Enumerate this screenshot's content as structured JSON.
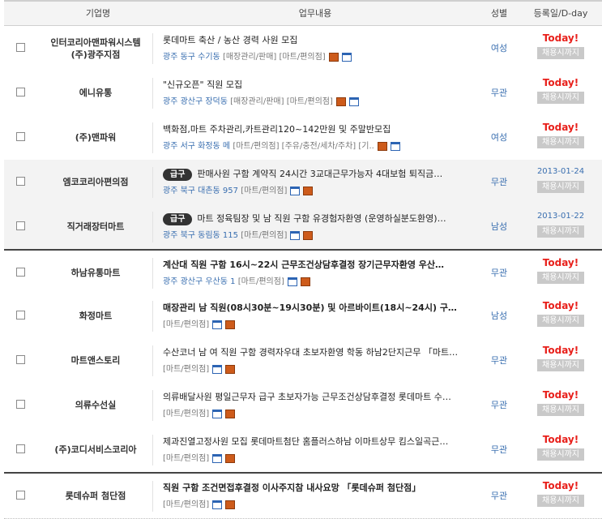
{
  "header": {
    "company": "기업명",
    "job": "업무내용",
    "gender": "성별",
    "date": "등록일/D-day"
  },
  "rows": [
    {
      "company": "인터코리아맨파워시스템\n(주)광주지점",
      "title": "롯데마트 축산 / 농산 경력 사원 모집",
      "bold": false,
      "badge": "",
      "location": "광주 동구 수기동",
      "categories": "[매장관리/판매] [마트/편의점]",
      "icons": [
        "scrap",
        "win"
      ],
      "gender": "여성",
      "date_type": "today",
      "date": "Today!",
      "closing": "채용시까지",
      "style": "white"
    },
    {
      "company": "에니유통",
      "title": "\"신규오픈\" 직원 모집",
      "bold": false,
      "badge": "",
      "location": "광주 광산구 장덕동",
      "categories": "[매장관리/판매] [마트/편의점]",
      "icons": [
        "scrap",
        "win"
      ],
      "gender": "무관",
      "date_type": "today",
      "date": "Today!",
      "closing": "채용시까지",
      "style": "white"
    },
    {
      "company": "(주)맨파워",
      "title": "백화점,마트 주차관리,카트관리120~142만원 및 주말반모집",
      "bold": false,
      "badge": "",
      "location": "광주 서구 화정동 메",
      "categories": "[마트/편의점] [주유/충전/세차/주차] [기..",
      "icons": [
        "scrap",
        "win"
      ],
      "gender": "여성",
      "date_type": "today",
      "date": "Today!",
      "closing": "채용시까지",
      "style": "white"
    },
    {
      "company": "엠코코리아편의점",
      "title": "판매사원 구함 계약직 24시간 3교대근무가능자 4대보험 퇴직금…",
      "bold": false,
      "badge": "급구",
      "location": "광주 북구 대촌동 957",
      "categories": "[마트/편의점]",
      "icons": [
        "win",
        "scrap"
      ],
      "gender": "무관",
      "date_type": "date",
      "date": "2013-01-24",
      "closing": "채용시까지",
      "style": "gray"
    },
    {
      "company": "직거래장터마트",
      "title": "마트 정육팀장 및 남 직원 구함 유경험자환영 (운영하실분도환영)…",
      "bold": false,
      "badge": "급구",
      "location": "광주 북구 동림동 115",
      "categories": "[마트/편의점]",
      "icons": [
        "win",
        "scrap"
      ],
      "gender": "남성",
      "date_type": "date",
      "date": "2013-01-22",
      "closing": "채용시까지",
      "style": "gray"
    },
    {
      "company": "하남유통마트",
      "title": "계산대 직원 구함 16시~22시 근무조건상담후결정 장기근무자환영 우산…",
      "bold": true,
      "badge": "",
      "location": "광주 광산구 우산동 1",
      "categories": "[마트/편의점]",
      "icons": [
        "win",
        "scrap"
      ],
      "gender": "무관",
      "date_type": "today",
      "date": "Today!",
      "closing": "채용시까지",
      "style": "sep"
    },
    {
      "company": "화정마트",
      "title": "매장관리 남 직원(08시30분~19시30분) 및 아르바이트(18시~24시) 구…",
      "bold": true,
      "badge": "",
      "location": "",
      "categories": "[마트/편의점]",
      "icons": [
        "win",
        "scrap"
      ],
      "gender": "남성",
      "date_type": "today",
      "date": "Today!",
      "closing": "채용시까지",
      "style": "white"
    },
    {
      "company": "마트앤스토리",
      "title": "수산코너 남 여 직원 구함 경력자우대 초보자환영 학동 하남2단지근무 「마트…",
      "bold": false,
      "badge": "",
      "location": "",
      "categories": "[마트/편의점]",
      "icons": [
        "win",
        "scrap"
      ],
      "gender": "무관",
      "date_type": "today",
      "date": "Today!",
      "closing": "채용시까지",
      "style": "white"
    },
    {
      "company": "의류수선실",
      "title": "의류배달사원 평일근무자 급구 초보자가능 근무조건상담후결정 롯데마트 수…",
      "bold": false,
      "badge": "",
      "location": "",
      "categories": "[마트/편의점]",
      "icons": [
        "win",
        "scrap"
      ],
      "gender": "무관",
      "date_type": "today",
      "date": "Today!",
      "closing": "채용시까지",
      "style": "white"
    },
    {
      "company": "(주)코디서비스코리아",
      "title": "제과진열고정사원 모집 롯데마트첨단 홈플러스하남 이마트상무 킴스일곡근…",
      "bold": false,
      "badge": "",
      "location": "",
      "categories": "[마트/편의점]",
      "icons": [
        "win",
        "scrap"
      ],
      "gender": "무관",
      "date_type": "today",
      "date": "Today!",
      "closing": "채용시까지",
      "style": "white"
    },
    {
      "company": "롯데슈퍼 첨단점",
      "title": "직원 구함 조건면접후결정 이사주지참 내사요망 「롯데슈퍼 첨단점」",
      "bold": true,
      "badge": "",
      "location": "",
      "categories": "[마트/편의점]",
      "icons": [
        "win",
        "scrap"
      ],
      "gender": "무관",
      "date_type": "today",
      "date": "Today!",
      "closing": "채용시까지",
      "style": "sep"
    }
  ]
}
